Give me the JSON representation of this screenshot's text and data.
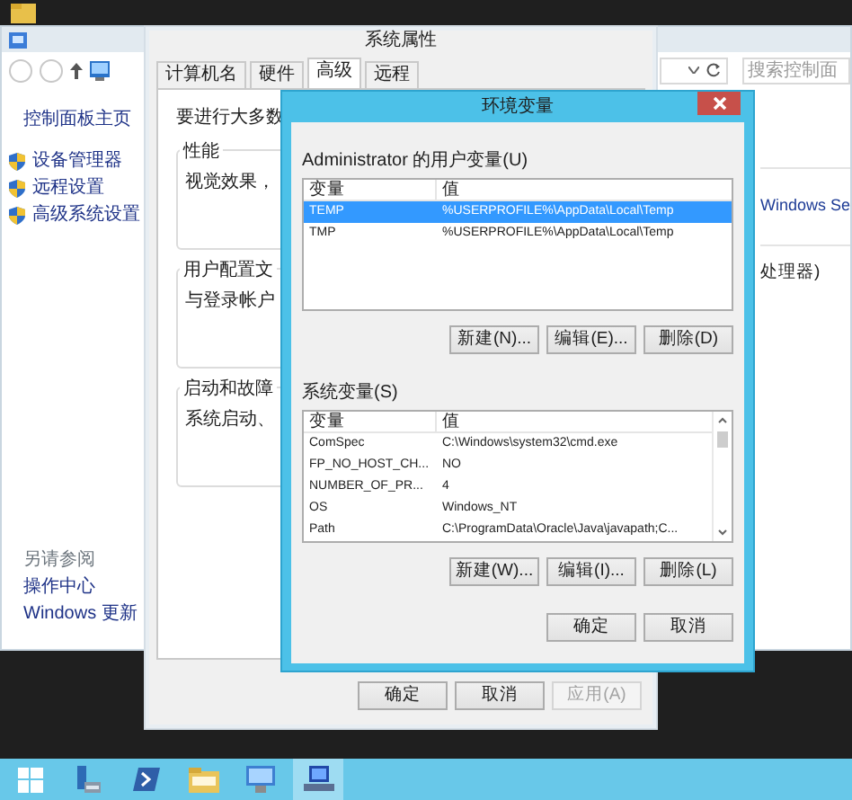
{
  "control_panel": {
    "nav_home": "控制面板主页",
    "tasks": [
      "设备管理器",
      "远程设置",
      "高级系统设置"
    ],
    "see_also_title": "另请参阅",
    "see_also": [
      "操作中心",
      "Windows 更新"
    ],
    "search": {
      "placeholder": "搜索控制面"
    },
    "heading": "Windows Se",
    "processor_text": "处理器)"
  },
  "system_properties": {
    "title": "系统属性",
    "tabs": [
      {
        "label": "计算机名",
        "selected": false
      },
      {
        "label": "硬件",
        "selected": false
      },
      {
        "label": "高级",
        "selected": true
      },
      {
        "label": "远程",
        "selected": false
      }
    ],
    "intro": "要进行大多数",
    "groups": [
      {
        "title": "性能",
        "text": "视觉效果，"
      },
      {
        "title": "用户配置文",
        "text": "与登录帐户"
      },
      {
        "title": "启动和故障",
        "text": "系统启动、"
      }
    ],
    "buttons": [
      {
        "label": "确定",
        "disabled": false
      },
      {
        "label": "取消",
        "disabled": false
      },
      {
        "label": "应用(A)",
        "disabled": true
      }
    ]
  },
  "environment_variables": {
    "title": "环境变量",
    "sections": [
      {
        "label": "Administrator 的用户变量(U)",
        "columns": [
          "变量",
          "值"
        ],
        "scrollbar": false,
        "rows": [
          {
            "name": "TEMP",
            "value": "%USERPROFILE%\\AppData\\Local\\Temp",
            "selected": true
          },
          {
            "name": "TMP",
            "value": "%USERPROFILE%\\AppData\\Local\\Temp",
            "selected": false
          }
        ],
        "buttons": [
          "新建(N)...",
          "编辑(E)...",
          "删除(D)"
        ]
      },
      {
        "label": "系统变量(S)",
        "columns": [
          "变量",
          "值"
        ],
        "scrollbar": true,
        "rows": [
          {
            "name": "ComSpec",
            "value": "C:\\Windows\\system32\\cmd.exe",
            "selected": false
          },
          {
            "name": "FP_NO_HOST_CH...",
            "value": "NO",
            "selected": false
          },
          {
            "name": "NUMBER_OF_PR...",
            "value": "4",
            "selected": false
          },
          {
            "name": "OS",
            "value": "Windows_NT",
            "selected": false
          },
          {
            "name": "Path",
            "value": "C:\\ProgramData\\Oracle\\Java\\javapath;C...",
            "selected": false
          }
        ],
        "buttons": [
          "新建(W)...",
          "编辑(I)...",
          "删除(L)"
        ]
      }
    ],
    "buttons": [
      "确定",
      "取消"
    ]
  },
  "taskbar": {
    "items": [
      {
        "kind": "start",
        "selected": false
      },
      {
        "kind": "server",
        "selected": false
      },
      {
        "kind": "shell",
        "selected": false
      },
      {
        "kind": "folder",
        "selected": false
      },
      {
        "kind": "control",
        "selected": false
      },
      {
        "kind": "remote",
        "selected": true
      }
    ]
  }
}
